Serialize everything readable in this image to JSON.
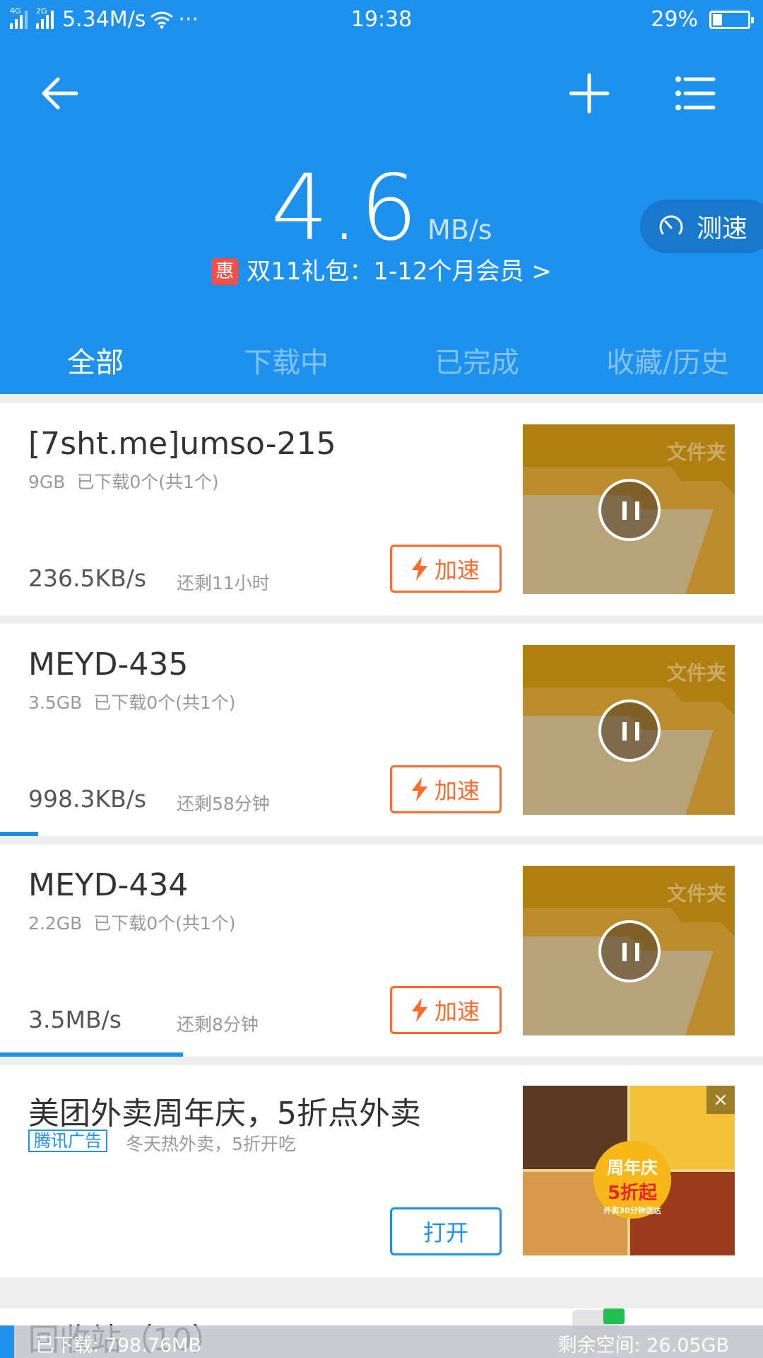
{
  "status_bar": {
    "net1": "4G",
    "net2": "2G",
    "net_speed": "5.34M/s",
    "dots": "···",
    "time": "19:38",
    "battery": "29%"
  },
  "header": {
    "speed_value": "4.6",
    "speed_unit": "MB/s",
    "promo_badge": "惠",
    "promo_text": "双11礼包：1-12个月会员 >",
    "speedtest_label": "测速"
  },
  "tabs": [
    {
      "label": "全部",
      "active": true
    },
    {
      "label": "下载中",
      "active": false
    },
    {
      "label": "已完成",
      "active": false
    },
    {
      "label": "收藏/历史",
      "active": false
    }
  ],
  "downloads": [
    {
      "name": "[7sht.me]umso-215",
      "size": "9GB",
      "files": "已下载0个(共1个)",
      "speed": "236.5KB/s",
      "eta": "还剩11小时",
      "boost": "加速",
      "folder_tag": "文件夹",
      "progress": 0.0
    },
    {
      "name": "MEYD-435",
      "size": "3.5GB",
      "files": "已下载0个(共1个)",
      "speed": "998.3KB/s",
      "eta": "还剩58分钟",
      "boost": "加速",
      "folder_tag": "文件夹",
      "progress": 0.05
    },
    {
      "name": "MEYD-434",
      "size": "2.2GB",
      "files": "已下载0个(共1个)",
      "speed": "3.5MB/s",
      "eta": "还剩8分钟",
      "boost": "加速",
      "folder_tag": "文件夹",
      "progress": 0.24
    }
  ],
  "ad": {
    "title": "美团外卖周年庆，5折点外卖",
    "tag": "腾讯广告",
    "subtitle": "冬天热外卖，5折开吃",
    "open_button": "打开",
    "badge_line1": "周年庆",
    "badge_line2": "5折起",
    "badge_line3": "外卖30分钟送达",
    "close": "×"
  },
  "recycle": {
    "title": "回收站（10）"
  },
  "bottom_bar": {
    "downloaded": "已下载: 798.76MB",
    "free_space": "剩余空间: 26.05GB"
  },
  "colors": {
    "primary": "#1e90ee",
    "boost": "#ff6a2d",
    "folder": "#b07f12"
  }
}
